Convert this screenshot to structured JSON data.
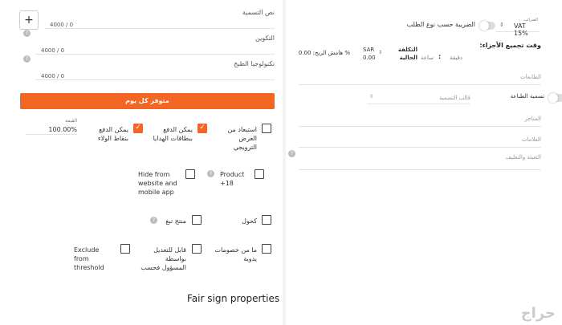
{
  "colors": {
    "accent": "#f26522",
    "page_bg": "#f3f3f3"
  },
  "left": {
    "plus_label": "+",
    "name_text": {
      "label": "نص التسمية",
      "counter": "4000 / 0"
    },
    "ingredients": {
      "label": "التكوين",
      "counter": "4000 / 0"
    },
    "cooking_tech": {
      "label": "تكنولوجيا الطبخ",
      "counter": "4000 / 0"
    },
    "available_button": "متوفر كل يوم",
    "value": {
      "label": "القيمة",
      "amount": "100.00%"
    },
    "checkboxes": {
      "loyalty": "يمكن الدفع بنقاط الولاء",
      "gift_cards": "يمكن الدفع ببطاقات الهدايا",
      "exclude_promo": "استبعاد من العرض الترويجي",
      "hide_web": "Hide from website and mobile app",
      "product18": "Product +18",
      "sold_product": "منتج تبغ",
      "alcohol": "كحول",
      "editable": "قابل للتعديل بواسطة المسؤول فحسب",
      "manual_discount": "ما من خصومات يدوية",
      "exclude_threshold": "Exclude from threshold"
    },
    "section_title": "Fair sign properties"
  },
  "right": {
    "vat": {
      "label": "الضرائب",
      "value": "VAT 15%"
    },
    "tax_by_order": "الضريبة حسب نوع الطلب",
    "assembly_time": "وقت تجميع الأجزاء:",
    "cost": {
      "label": "التكلفة الحالية",
      "currency": "SAR",
      "amount": "0.00"
    },
    "hour": "ساعة",
    "minute": "دقيقة",
    "margin": "% هامش الربح: 0.00",
    "stations": "الطابعات",
    "print_label": "تسمية الطباعة",
    "label_template": "قالب التسمية",
    "stores": "المتاجر",
    "tags": "العلامات",
    "packaging": "التعبئة والتغليف"
  },
  "watermark": "حراج"
}
